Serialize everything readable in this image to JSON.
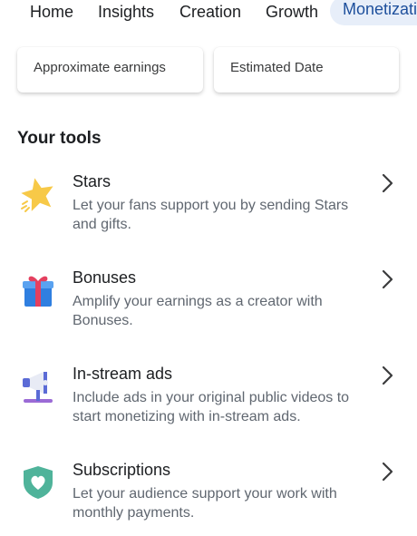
{
  "tabs": [
    {
      "label": "Home",
      "active": false
    },
    {
      "label": "Insights",
      "active": false
    },
    {
      "label": "Creation",
      "active": false
    },
    {
      "label": "Growth",
      "active": false
    },
    {
      "label": "Monetizati",
      "active": true
    }
  ],
  "cards": [
    {
      "label": "Approximate earnings"
    },
    {
      "label": "Estimated Date"
    }
  ],
  "tools_section": {
    "title": "Your tools",
    "items": [
      {
        "title": "Stars",
        "description": "Let your fans support you by sending Stars and gifts.",
        "icon": "star-icon"
      },
      {
        "title": "Bonuses",
        "description": "Amplify your earnings as a creator with Bonuses.",
        "icon": "gift-icon"
      },
      {
        "title": "In-stream ads",
        "description": "Include ads in your original public videos to start monetizing with in-stream ads.",
        "icon": "megaphone-icon"
      },
      {
        "title": "Subscriptions",
        "description": "Let your audience support your work with monthly payments.",
        "icon": "heart-shield-icon"
      }
    ]
  },
  "colors": {
    "accent": "#1d4f9c",
    "active_tab_bg": "#e7eef9",
    "star": "#f7c948",
    "gift": "#2f7fe0",
    "gift_ribbon": "#e4405f",
    "megaphone": "#5b6bd6",
    "heart_shield": "#4fb39a"
  }
}
